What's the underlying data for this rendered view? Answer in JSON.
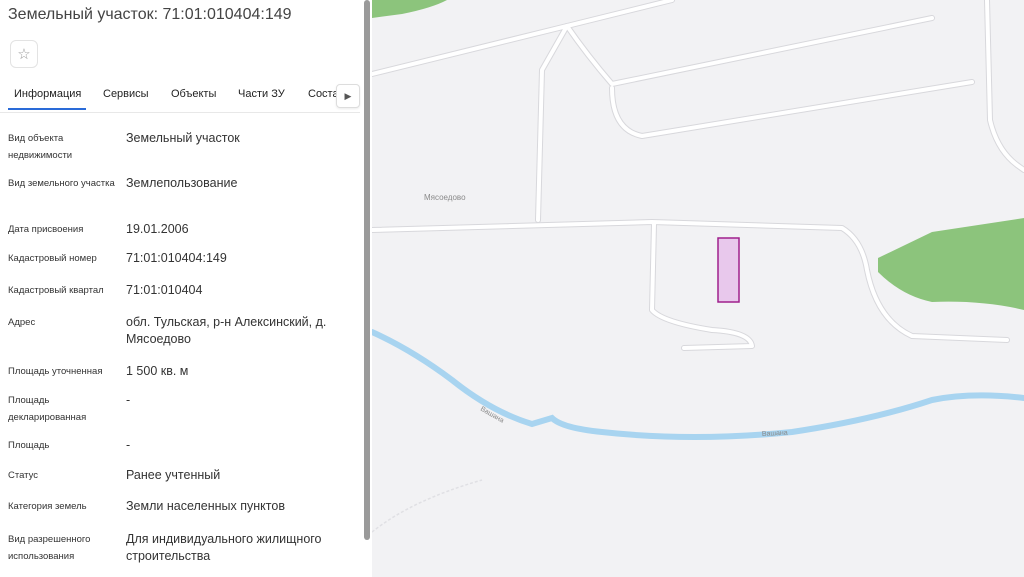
{
  "header": {
    "title": "Земельный участок: 71:01:010404:149"
  },
  "favorite": {
    "icon": "star-icon"
  },
  "tabs": [
    {
      "label": "Информация"
    },
    {
      "label": "Сервисы"
    },
    {
      "label": "Объекты"
    },
    {
      "label": "Части ЗУ"
    },
    {
      "label": "Состав"
    }
  ],
  "tab_scroll": {
    "icon": "chevron-right-icon"
  },
  "fields": [
    {
      "label": "Вид объекта недвижимости",
      "value": "Земельный участок"
    },
    {
      "label": "Вид земельного участка",
      "value": "Землепользование"
    },
    {
      "label": "Дата присвоения",
      "value": "19.01.2006"
    },
    {
      "label": "Кадастровый номер",
      "value": "71:01:010404:149"
    },
    {
      "label": "Кадастровый квартал",
      "value": "71:01:010404"
    },
    {
      "label": "Адрес",
      "value": "обл. Тульская, р-н Алексинский, д. Мясоедово"
    },
    {
      "label": "Площадь уточненная",
      "value": "1 500 кв. м"
    },
    {
      "label": "Площадь декларированная",
      "value": "-"
    },
    {
      "label": "Площадь",
      "value": "-"
    },
    {
      "label": "Статус",
      "value": "Ранее учтенный"
    },
    {
      "label": "Категория земель",
      "value": "Земли населенных пунктов"
    },
    {
      "label": "Вид разрешенного использования",
      "value": "Для индивидуального жилищного строительства"
    }
  ],
  "map": {
    "village_label": "Мясоедово",
    "river_label_1": "Вашана",
    "river_label_2": "Вашана",
    "colors": {
      "background": "#f2f2f4",
      "forest": "#8cc47c",
      "road": "#ffffff",
      "river": "#a8d4f0",
      "parcel_fill": "#e8c8ec",
      "parcel_stroke": "#a0208c"
    }
  }
}
